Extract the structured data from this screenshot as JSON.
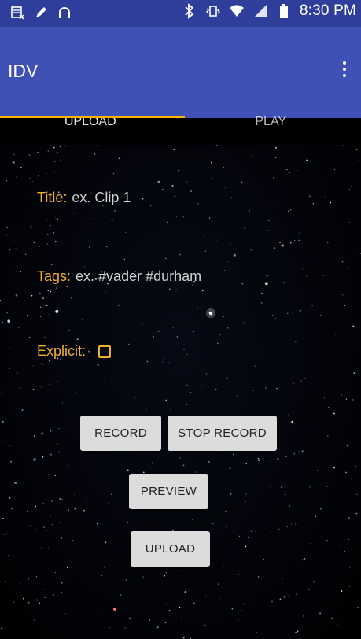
{
  "status_bar": {
    "icons_left": [
      "notification-icon",
      "pencil-icon",
      "headphones-icon"
    ],
    "icons_right": [
      "bluetooth-icon",
      "vibrate-icon",
      "wifi-icon",
      "signal-icon",
      "battery-icon"
    ],
    "time": "8:30 PM"
  },
  "app_bar": {
    "title": "IDV",
    "overflow_icon": "more-vert-icon",
    "accent_color": "#3f51b5",
    "indicator_color": "#ffb300"
  },
  "tabs": [
    {
      "label": "UPLOAD",
      "selected": true
    },
    {
      "label": "PLAY",
      "selected": false
    }
  ],
  "form": {
    "title_label": "Title:",
    "title_placeholder": "ex. Clip 1",
    "tags_label": "Tags:",
    "tags_placeholder": "ex. #vader #durham",
    "explicit_label": "Explicit:",
    "explicit_checked": false,
    "label_color": "#f0ad33"
  },
  "buttons": {
    "record": "RECORD",
    "stop_record": "STOP RECORD",
    "preview": "PREVIEW",
    "upload": "UPLOAD"
  }
}
